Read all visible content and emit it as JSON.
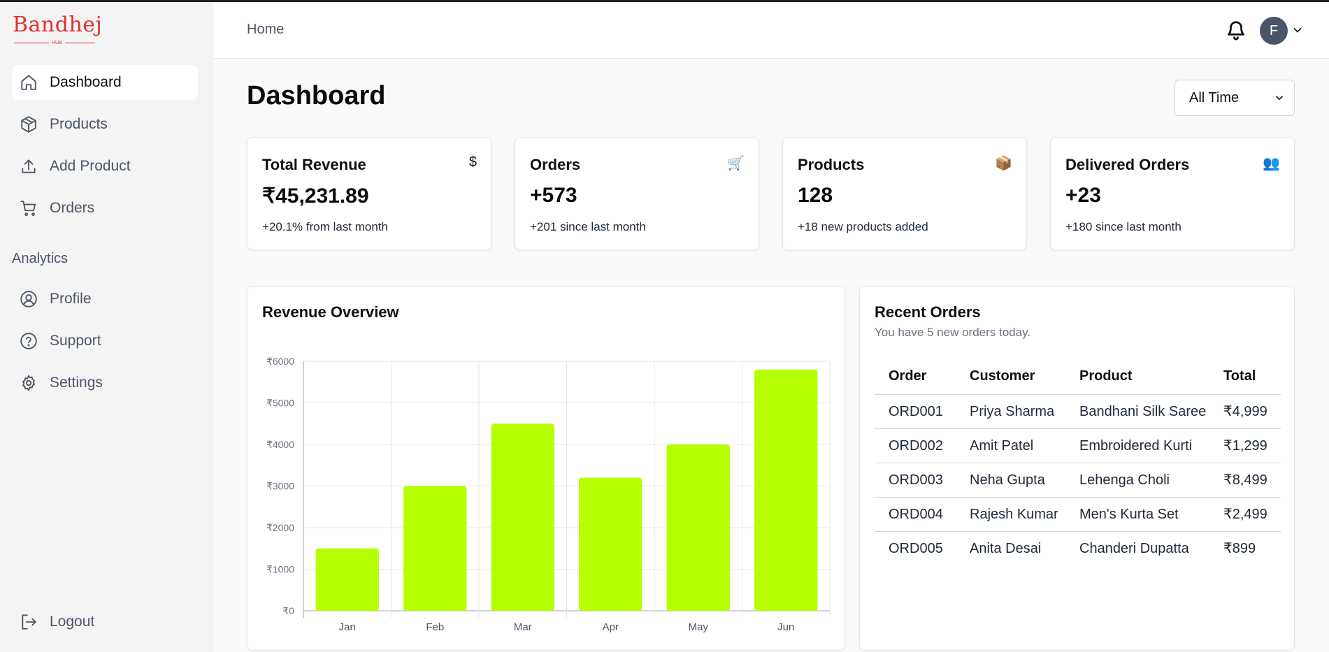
{
  "brand": {
    "logo_text": "Bandhej",
    "logo_sub": "HUB"
  },
  "sidebar": {
    "items": [
      {
        "label": "Dashboard",
        "icon": "home-icon",
        "active": true
      },
      {
        "label": "Products",
        "icon": "package-icon"
      },
      {
        "label": "Add Product",
        "icon": "upload-icon"
      },
      {
        "label": "Orders",
        "icon": "cart-icon"
      }
    ],
    "section_label": "Analytics",
    "analytics_items": [
      {
        "label": "Profile",
        "icon": "user-circle-icon"
      },
      {
        "label": "Support",
        "icon": "help-circle-icon"
      },
      {
        "label": "Settings",
        "icon": "gear-icon"
      }
    ],
    "logout_label": "Logout"
  },
  "header": {
    "breadcrumb": "Home",
    "avatar_initial": "F"
  },
  "main": {
    "title": "Dashboard",
    "period": "All Time"
  },
  "stats": [
    {
      "title": "Total Revenue",
      "icon": "dollar-icon",
      "icon_glyph": "$",
      "value": "₹45,231.89",
      "sub": "+20.1% from last month"
    },
    {
      "title": "Orders",
      "icon": "cart-emoji-icon",
      "icon_glyph": "🛒",
      "value": "+573",
      "sub": "+201 since last month"
    },
    {
      "title": "Products",
      "icon": "package-emoji-icon",
      "icon_glyph": "📦",
      "value": "128",
      "sub": "+18 new products added"
    },
    {
      "title": "Delivered Orders",
      "icon": "people-emoji-icon",
      "icon_glyph": "👥",
      "value": "+23",
      "sub": "+180 since last month"
    }
  ],
  "revenue": {
    "title": "Revenue Overview"
  },
  "chart_data": {
    "type": "bar",
    "title": "Revenue Overview",
    "categories": [
      "Jan",
      "Feb",
      "Mar",
      "Apr",
      "May",
      "Jun"
    ],
    "values": [
      1500,
      3000,
      4500,
      3200,
      4000,
      5800
    ],
    "ylim": [
      0,
      6000
    ],
    "yticks": [
      "₹0",
      "₹1000",
      "₹2000",
      "₹3000",
      "₹4000",
      "₹5000",
      "₹6000"
    ],
    "xlabel": "",
    "ylabel": "",
    "grid": true,
    "bar_color": "#b5ff00"
  },
  "recent_orders": {
    "title": "Recent Orders",
    "subtitle": "You have 5 new orders today.",
    "columns": [
      "Order",
      "Customer",
      "Product",
      "Total"
    ],
    "rows": [
      {
        "order": "ORD001",
        "customer": "Priya Sharma",
        "product": "Bandhani Silk Saree",
        "total": "₹4,999"
      },
      {
        "order": "ORD002",
        "customer": "Amit Patel",
        "product": "Embroidered Kurti",
        "total": "₹1,299"
      },
      {
        "order": "ORD003",
        "customer": "Neha Gupta",
        "product": "Lehenga Choli",
        "total": "₹8,499"
      },
      {
        "order": "ORD004",
        "customer": "Rajesh Kumar",
        "product": "Men's Kurta Set",
        "total": "₹2,499"
      },
      {
        "order": "ORD005",
        "customer": "Anita Desai",
        "product": "Chanderi Dupatta",
        "total": "₹899"
      }
    ]
  }
}
